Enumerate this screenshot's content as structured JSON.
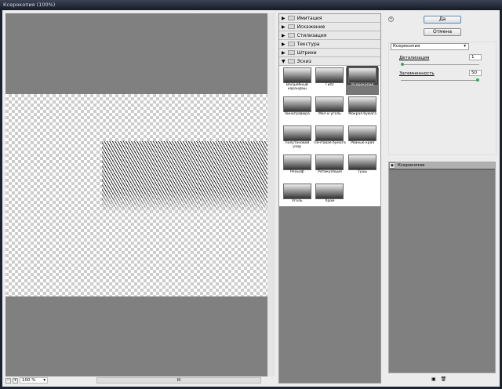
{
  "window": {
    "title": "Ксерокопия (100%)"
  },
  "preview": {
    "zoom": "100 %",
    "scroll_label": "III"
  },
  "filters": {
    "categories": [
      {
        "label": "Имитация",
        "expanded": false
      },
      {
        "label": "Искажение",
        "expanded": false
      },
      {
        "label": "Стилизация",
        "expanded": false
      },
      {
        "label": "Текстура",
        "expanded": false
      },
      {
        "label": "Штрихи",
        "expanded": false
      },
      {
        "label": "Эскиз",
        "expanded": true
      }
    ],
    "items": [
      "Волшебный карандаш",
      "Гипс",
      "Ксерокопия",
      "Линогравюра",
      "Мел и уголь",
      "Мокрая бумага",
      "Полутоновой узор",
      "Почтовая бумага",
      "Рваные края",
      "Рельеф",
      "Ретикуляция",
      "Тушь",
      "Уголь",
      "Хром"
    ],
    "selected": "Ксерокопия"
  },
  "buttons": {
    "ok": "Да",
    "cancel": "Отмена"
  },
  "settings": {
    "filter": "Ксерокопия",
    "detail_label": "Детализация",
    "detail_value": "1",
    "darkness_label": "Затемненность",
    "darkness_value": "50",
    "detail_fraction": 0.0,
    "darkness_fraction": 1.0
  },
  "layers": [
    {
      "name": "Ксерокопия"
    }
  ]
}
